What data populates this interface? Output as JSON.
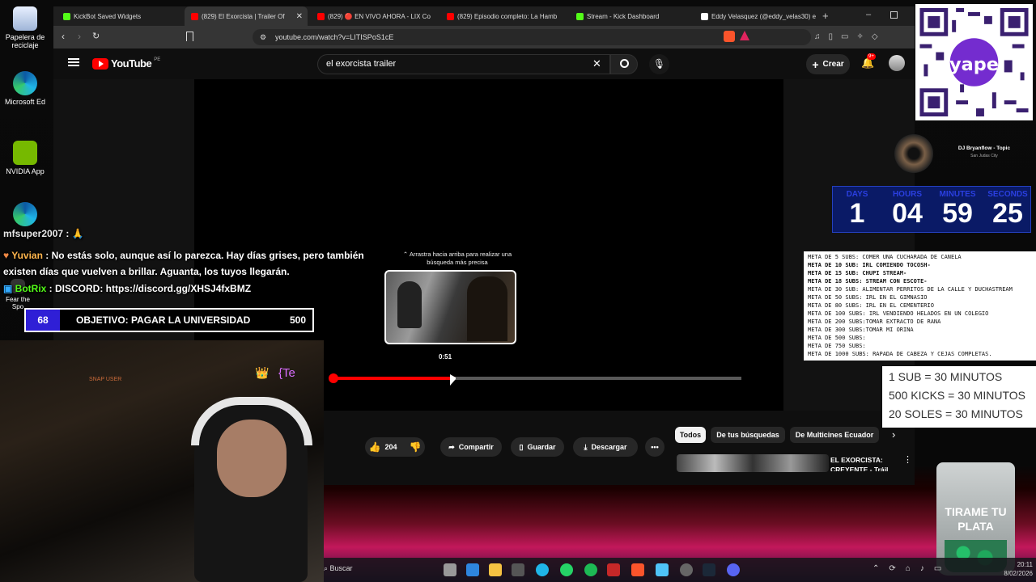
{
  "desktop": {
    "icons": [
      {
        "label": "Papelera de reciclaje"
      },
      {
        "label": "Microsoft Ed"
      },
      {
        "label": "NVIDIA App"
      },
      {
        "label": "Fear the Spo"
      }
    ]
  },
  "browser": {
    "tabs": [
      {
        "label": "KickBot Saved Widgets",
        "color": "#53fc18"
      },
      {
        "label": "(829) El Exorcista | Trailer Of",
        "color": "#ff0000",
        "active": true
      },
      {
        "label": "(829) 🔴 EN VIVO AHORA - LIX Co",
        "color": "#ff0000"
      },
      {
        "label": "(829) Episodio completo: La Hamb",
        "color": "#ff0000"
      },
      {
        "label": "Stream - Kick Dashboard",
        "color": "#53fc18"
      },
      {
        "label": "Eddy Velasquez (@eddy_velas30) e",
        "color": "#ffffff"
      }
    ],
    "url": "youtube.com/watch?v=LITISPoS1cE"
  },
  "youtube": {
    "logo": "YouTube",
    "country": "PE",
    "search_value": "el exorcista trailer",
    "create_label": "Crear",
    "notif_count": "9+",
    "hint": "Arrastra hacia arriba para realizar una búsqueda más precisa",
    "preview_time": "0:51",
    "progress": 0.3,
    "actions": {
      "likes": "204",
      "share": "Compartir",
      "save": "Guardar",
      "download": "Descargar"
    },
    "chips": [
      "Todos",
      "De tus búsquedas",
      "De Multicines Ecuador"
    ],
    "rec_title": "EL EXORCISTA: CREYENTE - Tráil"
  },
  "overlay": {
    "chat": [
      {
        "user": "mfsuper2007",
        "text": ""
      },
      {
        "user": "Yuvian",
        "text": "No estás solo, aunque así lo parezca. Hay días grises, pero también existen días que vuelven a brillar. Aguanta, los tuyos llegarán."
      },
      {
        "user": "BotRix",
        "text": "DISCORD: https://discord.gg/XHSJ4fxBMZ"
      }
    ],
    "goal": {
      "current": "68",
      "label": "OBJETIVO: PAGAR LA UNIVERSIDAD",
      "target": "500"
    },
    "snap_user": "SNAP USER",
    "crown_text": "{Te",
    "timer": {
      "days_label": "DAYS",
      "days": "1",
      "hours_label": "HOURS",
      "hours": "04",
      "minutes_label": "MINUTES",
      "minutes": "59",
      "seconds_label": "SECONDS",
      "seconds": "25"
    },
    "dj": {
      "name": "DJ Bryanflow - Topic",
      "sub": "San Judas City"
    },
    "metas": [
      "META DE 5 SUBS: COMER UNA CUCHARADA DE CANELA",
      "META DE 10 SUB: IRL COMIENDO TOCOSH-",
      "META DE 15 SUB: CHUPI STREAM-",
      "META DE 18 SUBS: STREAM CON ESCOTE-",
      "META DE 30 SUB:  ALIMENTAR PERRITOS DE LA CALLE Y DUCHASTREAM",
      "META DE 50 SUBS: IRL EN EL GIMNASIO",
      "META DE 80 SUBS: IRL EN EL CEMENTERIO",
      "META DE 100 SUBS: IRL VENDIENDO HELADOS EN UN COLEGIO",
      "META DE 200 SUBS:TOMAR EXTRACTO DE RANA",
      "META DE 300 SUBS:TOMAR MI ORINA",
      "META DE 500 SUBS:",
      "META DE 750 SUBS:",
      "META DE 1000 SUBS: RAPADA DE CABEZA Y CEJAS COMPLETAS."
    ],
    "rates": [
      "1 SUB = 30 MINUTOS",
      "500 KICKS = 30 MINUTOS",
      "20 SOLES = 30 MINUTOS"
    ],
    "qr_brand": "yape",
    "jar_text": "TIRAME TU PLATA"
  },
  "taskbar": {
    "search_placeholder": "Buscar",
    "time": "20:11",
    "date": "8/02/2026"
  }
}
